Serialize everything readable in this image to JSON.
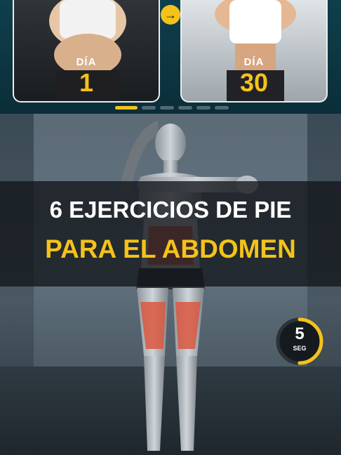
{
  "cards": {
    "left": {
      "label": "DÍA",
      "number": "1"
    },
    "right": {
      "label": "DÍA",
      "number": "30"
    },
    "arrow_icon": "arrow-right-icon"
  },
  "carousel": {
    "total": 6,
    "active": 1
  },
  "title": {
    "line1": "6 EJERCICIOS DE PIE",
    "line2": "PARA EL ABDOMEN"
  },
  "timer": {
    "value": "5",
    "unit": "SEG",
    "progress": 0.5
  },
  "colors": {
    "accent": "#f4c21a",
    "highlight_muscle": "#d9573f",
    "band": "#0f3f4c"
  }
}
